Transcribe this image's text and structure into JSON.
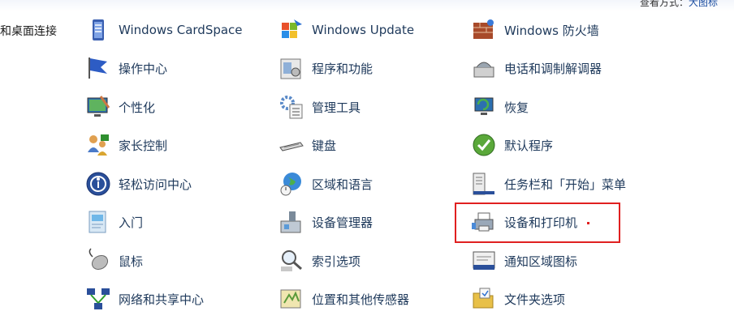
{
  "header": {
    "view_label": "查看方式：",
    "view_value": "大图标"
  },
  "left_fragment": "和桌面连接",
  "columns": [
    [
      {
        "label": "Windows CardSpace",
        "icon": "cardspace-icon"
      },
      {
        "label": "操作中心",
        "icon": "action-center-flag-icon"
      },
      {
        "label": "个性化",
        "icon": "personalization-icon"
      },
      {
        "label": "家长控制",
        "icon": "parental-controls-icon"
      },
      {
        "label": "轻松访问中心",
        "icon": "ease-of-access-icon"
      },
      {
        "label": "入门",
        "icon": "getting-started-icon"
      },
      {
        "label": "鼠标",
        "icon": "mouse-icon"
      },
      {
        "label": "网络和共享中心",
        "icon": "network-sharing-icon"
      }
    ],
    [
      {
        "label": "Windows Update",
        "icon": "windows-update-icon"
      },
      {
        "label": "程序和功能",
        "icon": "programs-features-icon"
      },
      {
        "label": "管理工具",
        "icon": "admin-tools-icon"
      },
      {
        "label": "键盘",
        "icon": "keyboard-icon"
      },
      {
        "label": "区域和语言",
        "icon": "region-language-icon"
      },
      {
        "label": "设备管理器",
        "icon": "device-manager-icon"
      },
      {
        "label": "索引选项",
        "icon": "indexing-options-icon"
      },
      {
        "label": "位置和其他传感器",
        "icon": "location-sensors-icon"
      }
    ],
    [
      {
        "label": "Windows 防火墙",
        "icon": "firewall-icon"
      },
      {
        "label": "电话和调制解调器",
        "icon": "phone-modem-icon"
      },
      {
        "label": "恢复",
        "icon": "recovery-icon"
      },
      {
        "label": "默认程序",
        "icon": "default-programs-icon"
      },
      {
        "label": "任务栏和「开始」菜单",
        "icon": "taskbar-start-menu-icon"
      },
      {
        "label": "设备和打印机",
        "icon": "devices-printers-icon"
      },
      {
        "label": "通知区域图标",
        "icon": "notification-area-icon"
      },
      {
        "label": "文件夹选项",
        "icon": "folder-options-icon"
      }
    ]
  ],
  "colors": {
    "link": "#1e395b",
    "highlight": "#e02020"
  }
}
